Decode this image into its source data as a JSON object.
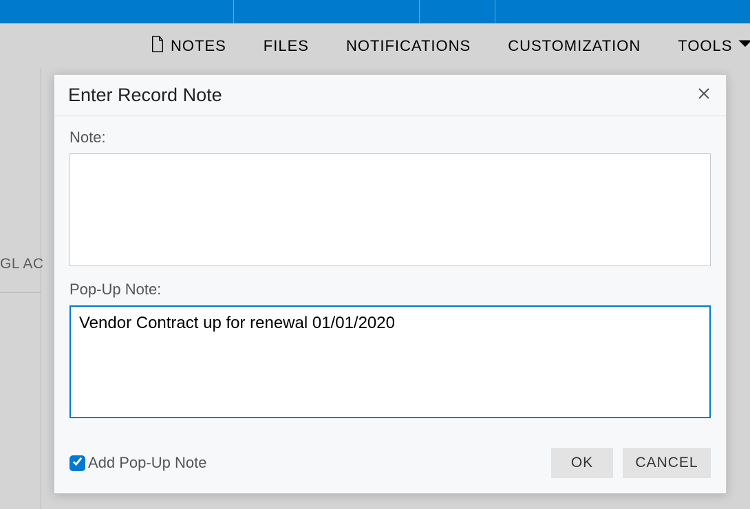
{
  "tabs": {
    "notes": "NOTES",
    "files": "FILES",
    "notifications": "NOTIFICATIONS",
    "customization": "CUSTOMIZATION",
    "tools": "TOOLS"
  },
  "sidebar": {
    "truncated_label": "GL AC"
  },
  "dialog": {
    "title": "Enter Record Note",
    "note_label": "Note:",
    "note_value": "",
    "popup_label": "Pop-Up Note:",
    "popup_value": "Vendor Contract up for renewal 01/01/2020",
    "add_popup_checked": true,
    "add_popup_label": "Add Pop-Up Note",
    "ok_label": "OK",
    "cancel_label": "CANCEL"
  }
}
